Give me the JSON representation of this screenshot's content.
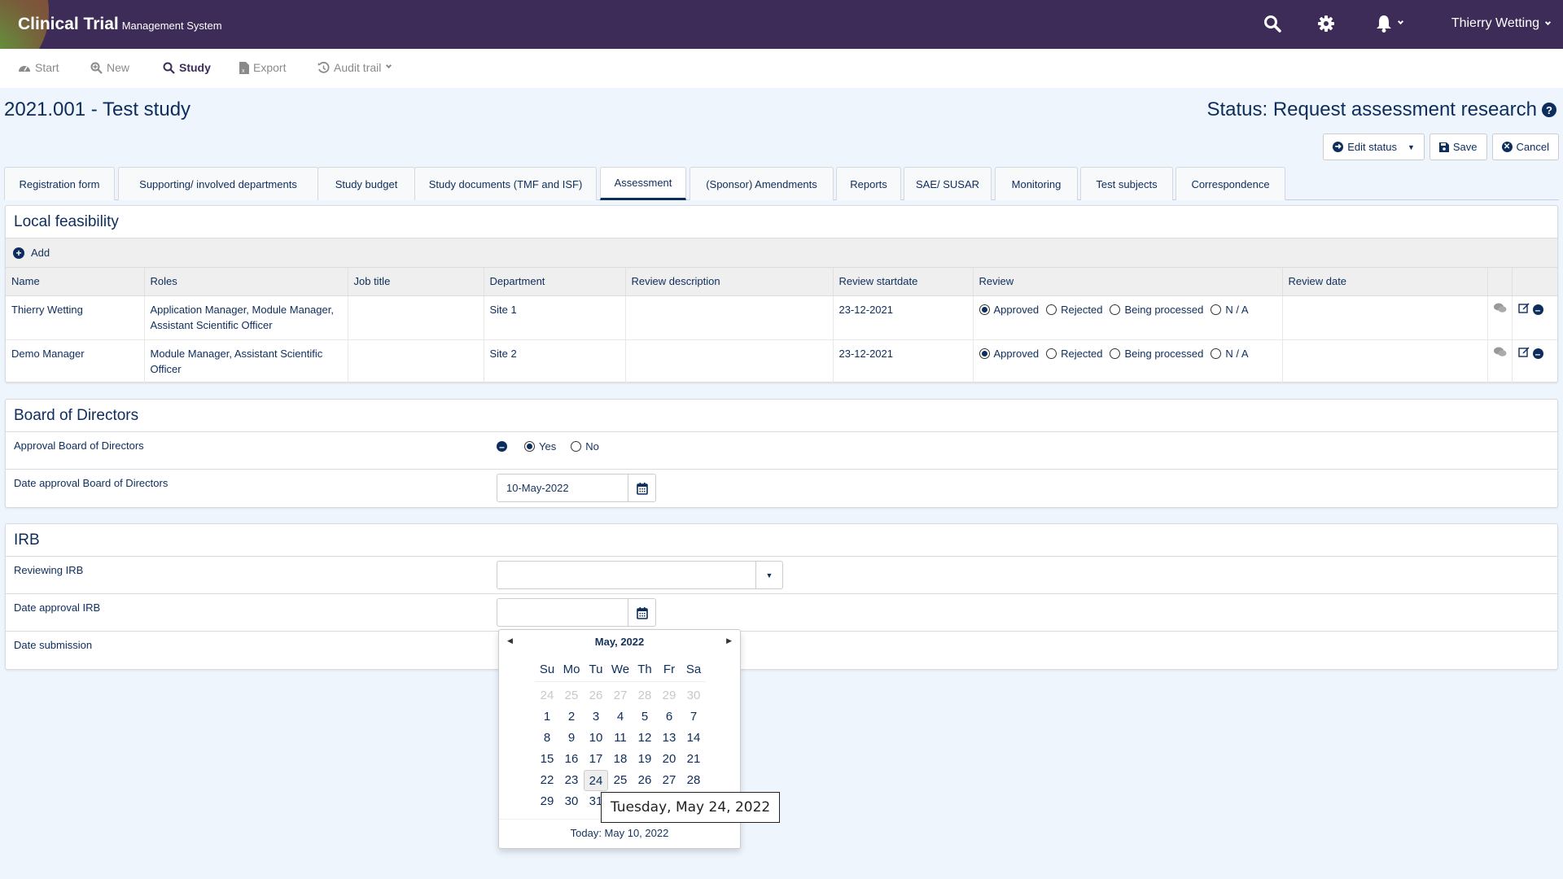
{
  "header": {
    "brand_main": "Clinical Trial",
    "brand_sub": "Management System",
    "user": "Thierry Wetting",
    "icons": [
      "search-icon",
      "gear-icon",
      "bell-icon"
    ]
  },
  "toolbar": [
    {
      "label": "Start",
      "icon": "dashboard-icon"
    },
    {
      "label": "New",
      "icon": "zoom-plus-icon"
    },
    {
      "label": "Study",
      "icon": "search-icon",
      "active": true
    },
    {
      "label": "Export",
      "icon": "excel-file-icon"
    },
    {
      "label": "Audit trail",
      "icon": "history-icon",
      "dropdown": true
    }
  ],
  "page": {
    "title": "2021.001 - Test study",
    "status": "Status: Request assessment research",
    "buttons": {
      "edit_status": "Edit status",
      "save": "Save",
      "cancel": "Cancel"
    }
  },
  "tabs": [
    {
      "label": "Registration form"
    },
    {
      "label": "Supporting/ involved departments"
    },
    {
      "label": "Study budget"
    },
    {
      "label": "Study documents (TMF and ISF)"
    },
    {
      "label": "Assessment",
      "active": true
    },
    {
      "label": "(Sponsor) Amendments"
    },
    {
      "label": "Reports"
    },
    {
      "label": "SAE/ SUSAR"
    },
    {
      "label": "Monitoring"
    },
    {
      "label": "Test subjects"
    },
    {
      "label": "Correspondence"
    }
  ],
  "local_feasibility": {
    "title": "Local feasibility",
    "add_label": "Add",
    "columns": [
      "Name",
      "Roles",
      "Job title",
      "Department",
      "Review description",
      "Review startdate",
      "Review",
      "Review date",
      "",
      ""
    ],
    "review_options": [
      "Approved",
      "Rejected",
      "Being processed",
      "N / A"
    ],
    "rows": [
      {
        "name": "Thierry Wetting",
        "roles": "Application Manager, Module Manager, Assistant Scientific Officer",
        "job_title": "",
        "department": "Site 1",
        "review_description": "",
        "review_startdate": "23-12-2021",
        "review": "Approved",
        "review_date": ""
      },
      {
        "name": "Demo Manager",
        "roles": "Module Manager, Assistant Scientific Officer",
        "job_title": "",
        "department": "Site 2",
        "review_description": "",
        "review_startdate": "23-12-2021",
        "review": "Approved",
        "review_date": ""
      }
    ]
  },
  "board": {
    "title": "Board of Directors",
    "approval_label": "Approval Board of Directors",
    "approval_options": [
      "Yes",
      "No"
    ],
    "approval_value": "Yes",
    "date_label": "Date approval Board of Directors",
    "date_value": "10-May-2022"
  },
  "irb": {
    "title": "IRB",
    "reviewing_label": "Reviewing IRB",
    "reviewing_value": "",
    "date_label": "Date approval IRB",
    "date_value": "",
    "submission_label": "Date submission"
  },
  "datepicker": {
    "month": "May, 2022",
    "weekdays": [
      "Su",
      "Mo",
      "Tu",
      "We",
      "Th",
      "Fr",
      "Sa"
    ],
    "weeks": [
      [
        "24",
        "25",
        "26",
        "27",
        "28",
        "29",
        "30"
      ],
      [
        "1",
        "2",
        "3",
        "4",
        "5",
        "6",
        "7"
      ],
      [
        "8",
        "9",
        "10",
        "11",
        "12",
        "13",
        "14"
      ],
      [
        "15",
        "16",
        "17",
        "18",
        "19",
        "20",
        "21"
      ],
      [
        "22",
        "23",
        "24",
        "25",
        "26",
        "27",
        "28"
      ],
      [
        "29",
        "30",
        "31",
        "",
        "",
        "",
        ""
      ]
    ],
    "other_month_week": 0,
    "hovered": "24",
    "tooltip": "Tuesday, May 24, 2022",
    "today": "Today: May 10, 2022"
  }
}
